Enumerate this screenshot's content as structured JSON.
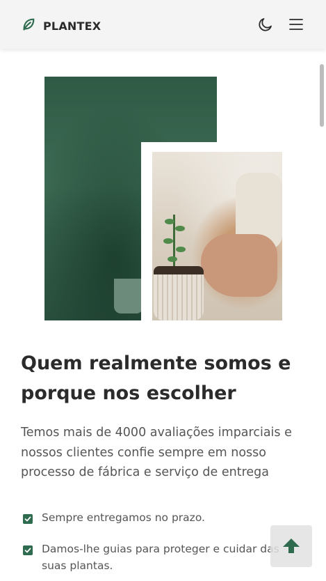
{
  "header": {
    "brand": "PLANTEX",
    "icons": {
      "logo": "leaf-icon",
      "theme": "moon-icon",
      "menu": "menu-icon"
    }
  },
  "about": {
    "title": "Quem realmente somos e porque nos escolher",
    "description": "Temos mais de 4000 avaliações imparciais e nossos clientes confie sempre em nosso processo de fábrica e serviço de entrega",
    "items": [
      "Sempre entregamos no prazo.",
      "Damos-lhe guias para proteger e cuidar das suas plantas."
    ]
  },
  "scroll_up": {
    "icon": "arrow-up-icon"
  },
  "colors": {
    "accent": "#2f6b4e",
    "header_bg": "#f4f4f4",
    "text": "#555555"
  }
}
